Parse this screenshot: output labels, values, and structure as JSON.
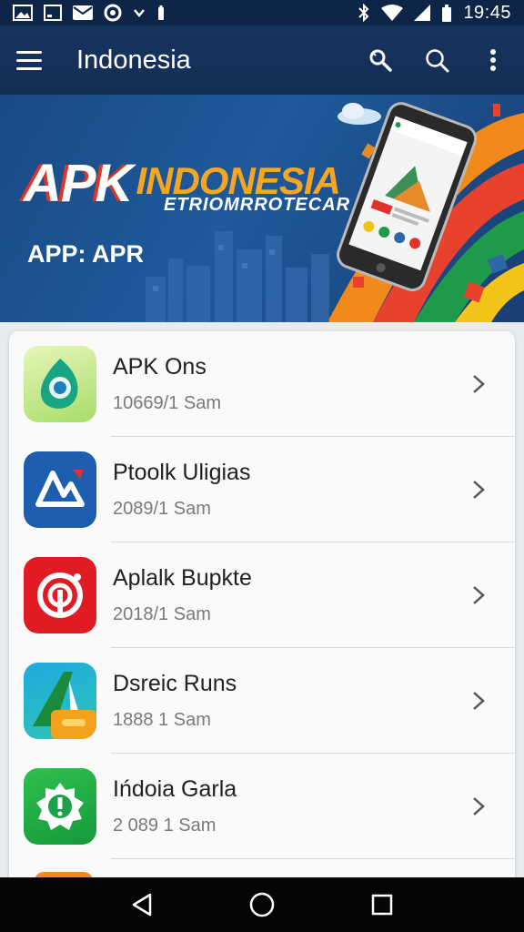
{
  "status_bar": {
    "time": "19:45",
    "icons": [
      "image-icon",
      "screen-icon",
      "mail-icon",
      "target-icon",
      "chevron-icon",
      "battery-small-icon",
      "bluetooth-icon",
      "wifi-icon",
      "signal-icon",
      "battery-icon"
    ]
  },
  "app_bar": {
    "title": "Indonesia",
    "actions": [
      "wrench-search-icon",
      "search-icon",
      "more-icon"
    ]
  },
  "banner": {
    "title_apk": "APK",
    "title_indo": "INDONESIA",
    "subtitle": "ETRIOMRROTECAR",
    "tag": "APP: APR"
  },
  "apps": [
    {
      "name": "APK Ons",
      "meta": "10669/1 Sam",
      "icon": "apk-ons-icon"
    },
    {
      "name": "Ptoolk Uligias",
      "meta": "2089/1 Sam",
      "icon": "ptoolk-icon"
    },
    {
      "name": "Aplalk Bupkte",
      "meta": "2018/1 Sam",
      "icon": "aplalk-icon"
    },
    {
      "name": "Dsreic Runs",
      "meta": "1888 1 Sam",
      "icon": "dsreic-icon"
    },
    {
      "name": "Ińdoia Garla",
      "meta": "2 089 1 Sam",
      "icon": "indoia-icon"
    }
  ],
  "colors": {
    "app_bar": "#17345f",
    "banner": "#1e5a9c",
    "accent_orange": "#f6a623",
    "accent_red": "#e0342b"
  }
}
